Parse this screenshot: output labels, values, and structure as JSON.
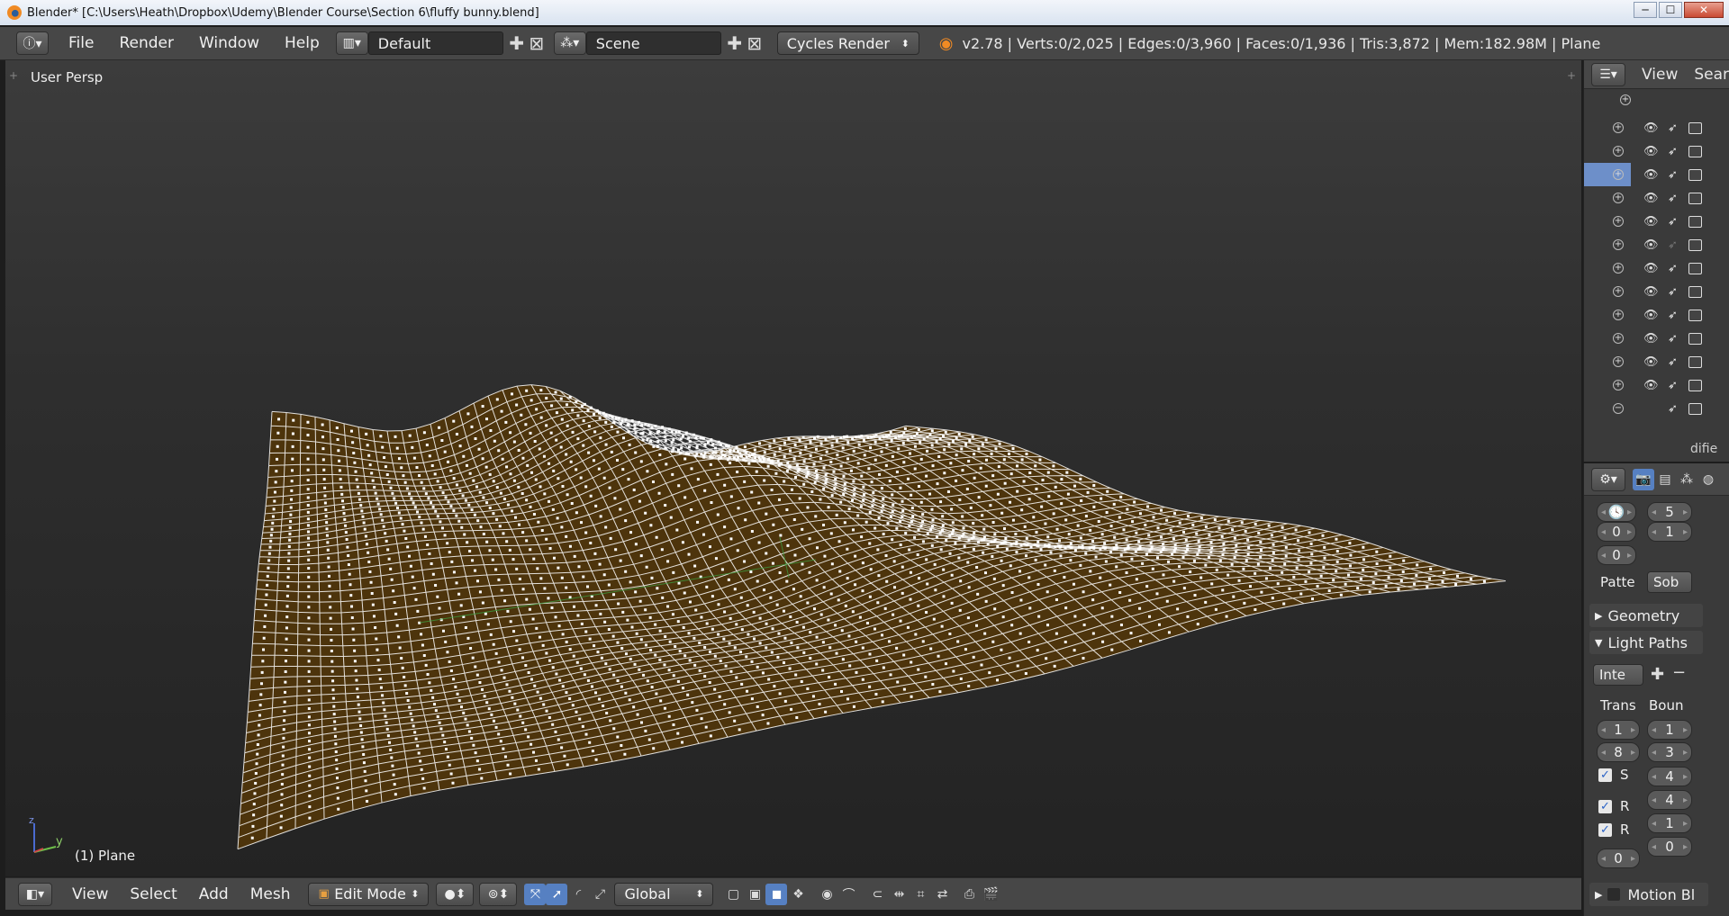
{
  "window": {
    "title": "Blender* [C:\\Users\\Heath\\Dropbox\\Udemy\\Blender Course\\Section 6\\fluffy bunny.blend]",
    "min": "─",
    "max": "☐",
    "close": "✕"
  },
  "info_header": {
    "menus": [
      "File",
      "Render",
      "Window",
      "Help"
    ],
    "screen_layout": "Default",
    "scene": "Scene",
    "render_engine": "Cycles Render",
    "stats": "v2.78 | Verts:0/2,025 | Edges:0/3,960 | Faces:0/1,936 | Tris:3,872 | Mem:182.98M | Plane"
  },
  "viewport": {
    "view_label": "User Persp",
    "object_label": "(1) Plane",
    "axis_y": "y",
    "axis_z": "z",
    "mesh_fill": "#4d340c",
    "wire_color": "#ffffff"
  },
  "view3d_header": {
    "menus": [
      "View",
      "Select",
      "Add",
      "Mesh"
    ],
    "mode": "Edit Mode",
    "orientation": "Global"
  },
  "outliner": {
    "view_label": "View",
    "search_label": "Sear",
    "rows": 13,
    "selected_row": 2,
    "footer_text": "difie"
  },
  "properties": {
    "top_left": [
      "",
      "0",
      "0"
    ],
    "top_right": [
      "5",
      "1"
    ],
    "pattern_label": "Patte",
    "pattern_value": "Sob",
    "panels": {
      "geometry": "Geometry",
      "light_paths": "Light Paths"
    },
    "integrator_value": "Inte",
    "col_trans": "Trans",
    "col_boun": "Boun",
    "trans_values": [
      "1",
      "8"
    ],
    "boun_values": [
      "1",
      "3",
      "4",
      "4",
      "1",
      "0"
    ],
    "checks": [
      "S",
      "R",
      "R"
    ],
    "last_left": "0",
    "motion_label": "Motion Bl"
  }
}
